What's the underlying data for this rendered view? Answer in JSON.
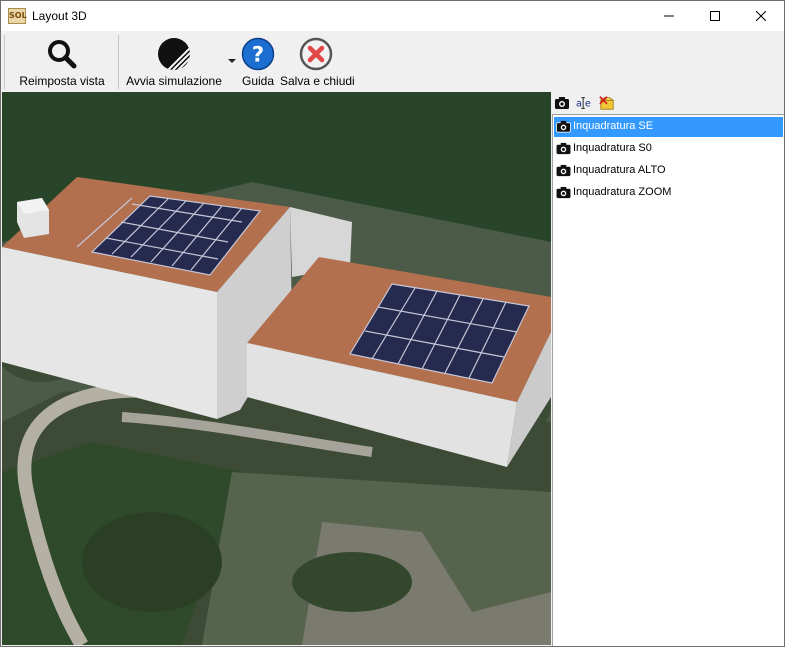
{
  "window": {
    "title": "Layout 3D",
    "app_icon_text": "SOL"
  },
  "toolbar": {
    "reset_view_label": "Reimposta vista",
    "start_simulation_label": "Avvia simulazione",
    "help_label": "Guida",
    "save_close_label": "Salva e chiudi"
  },
  "views": {
    "items": [
      {
        "label": "Inquadratura SE",
        "selected": true
      },
      {
        "label": "Inquadratura S0",
        "selected": false
      },
      {
        "label": "Inquadratura ALTO",
        "selected": false
      },
      {
        "label": "Inquadratura ZOOM",
        "selected": false
      }
    ]
  },
  "colors": {
    "selection": "#3399ff",
    "help_icon": "#1c6fd1",
    "close_icon": "#e04848",
    "roof": "#b2704e",
    "solar_panel": "#252a4e",
    "background_ground": "#28452a"
  }
}
